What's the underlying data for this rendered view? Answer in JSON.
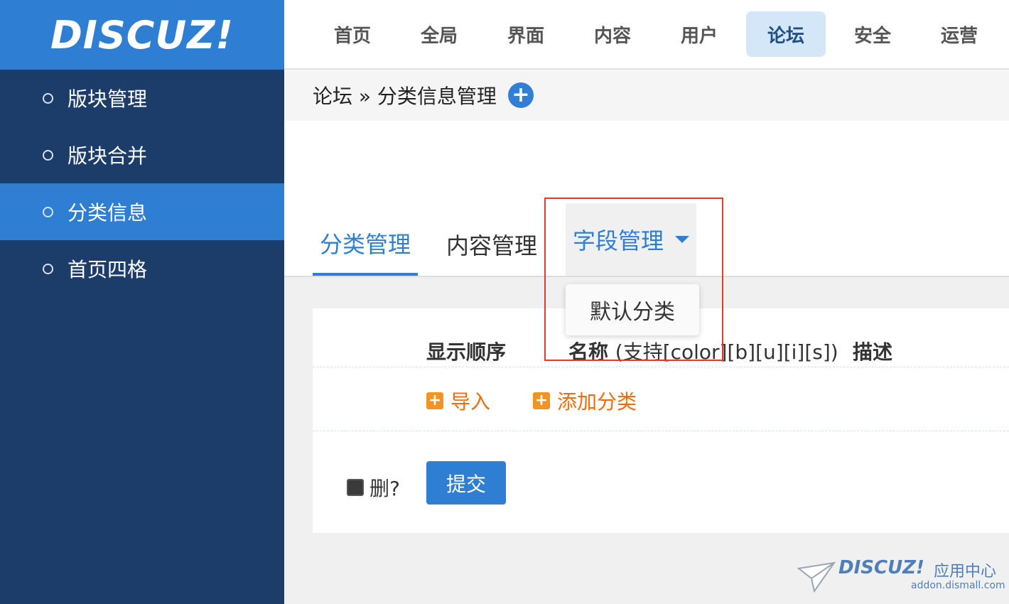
{
  "logo": {
    "text": "DISCUZ!"
  },
  "sidebar": {
    "items": [
      {
        "label": "版块管理"
      },
      {
        "label": "版块合并"
      },
      {
        "label": "分类信息"
      },
      {
        "label": "首页四格"
      }
    ],
    "active_index": 2
  },
  "topnav": {
    "items": [
      {
        "label": "首页"
      },
      {
        "label": "全局"
      },
      {
        "label": "界面"
      },
      {
        "label": "内容"
      },
      {
        "label": "用户"
      },
      {
        "label": "论坛"
      },
      {
        "label": "安全"
      },
      {
        "label": "运营"
      }
    ],
    "active_index": 5
  },
  "breadcrumb": {
    "text": "论坛 » 分类信息管理",
    "add_icon": "plus-circle-icon"
  },
  "tabs": {
    "items": [
      {
        "label": "分类管理"
      },
      {
        "label": "内容管理"
      },
      {
        "label": "字段管理"
      }
    ],
    "active_index": 0,
    "dropdown_option": "默认分类"
  },
  "table": {
    "headers": {
      "order": "显示顺序",
      "name": "名称",
      "name_hint": "(支持[color][b][u][i][s])",
      "desc": "描述"
    },
    "actions": {
      "import": "导入",
      "add_category": "添加分类"
    },
    "delete_label": "删?",
    "submit_label": "提交"
  },
  "watermark": {
    "logo": "DISCUZ!",
    "subtitle": "应用中心",
    "url": "addon.dismall.com"
  },
  "colors": {
    "sidebar_bg": "#1c3c6a",
    "accent": "#2e7fd4",
    "active_nav_bg": "#d4e7f9",
    "action_orange": "#f26c0d",
    "annotation_red": "#e8392f"
  }
}
